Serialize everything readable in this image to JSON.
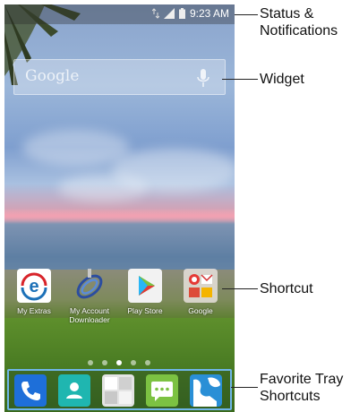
{
  "status_bar": {
    "time": "9:23 AM",
    "icons": [
      "data-arrows-icon",
      "signal-icon",
      "battery-icon"
    ]
  },
  "widget": {
    "search_text": "Google",
    "icon": "mic-icon"
  },
  "shortcuts": [
    {
      "label": "My Extras",
      "icon": "my-extras-icon"
    },
    {
      "label": "My Account Downloader",
      "icon": "my-account-downloader-icon"
    },
    {
      "label": "Play Store",
      "icon": "play-store-icon"
    },
    {
      "label": "Google",
      "icon": "google-folder-icon"
    }
  ],
  "page_indicator": {
    "count": 5,
    "active_index": 2
  },
  "favorite_tray": [
    {
      "icon": "phone-icon"
    },
    {
      "icon": "contacts-icon"
    },
    {
      "icon": "apps-icon"
    },
    {
      "icon": "messaging-icon"
    },
    {
      "icon": "maps-icon"
    }
  ],
  "callouts": {
    "status": "Status & Notifications",
    "widget": "Widget",
    "shortcut": "Shortcut",
    "tray": "Favorite Tray Shortcuts"
  },
  "colors": {
    "tray_border": "#6fb6e8",
    "phone_icon": "#1e6fd9",
    "contacts_icon": "#1fb6b0",
    "messaging_icon": "#7cc242",
    "maps_icon": "#2a8fd6"
  }
}
